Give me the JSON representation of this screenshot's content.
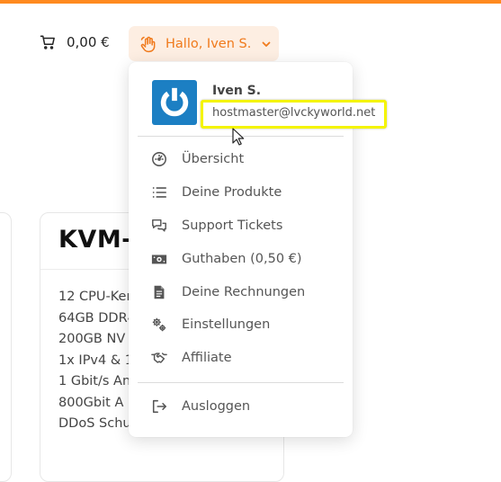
{
  "header": {
    "cart_total": "0,00 €",
    "greeting": "Hallo, Iven S.",
    "accent_color": "#f07a1c",
    "icons": {
      "cart": "cart-icon",
      "greeting": "waving-hand-icon",
      "chevron": "chevron-down-icon"
    }
  },
  "product_card": {
    "title": "KVM-",
    "features": [
      "12 CPU-Ker",
      "64GB DDR4",
      "200GB NV",
      "1x IPv4 & 1x",
      "1 Gbit/s An",
      "800Gbit A",
      "DDoS Schu"
    ]
  },
  "user_menu": {
    "user_name": "Iven S.",
    "email": "hostmaster@lvckyworld.net",
    "avatar_icon": "power-icon",
    "items": [
      {
        "label": "Übersicht",
        "icon": "dashboard-gauge-icon"
      },
      {
        "label": "Deine Produkte",
        "icon": "list-icon"
      },
      {
        "label": "Support Tickets",
        "icon": "chat-bubbles-icon"
      },
      {
        "label": "Guthaben (0,50 €)",
        "icon": "money-icon"
      },
      {
        "label": "Deine Rechnungen",
        "icon": "document-icon"
      },
      {
        "label": "Einstellungen",
        "icon": "gears-icon"
      },
      {
        "label": "Affiliate",
        "icon": "handshake-icon"
      }
    ],
    "logout": {
      "label": "Ausloggen",
      "icon": "logout-icon"
    }
  }
}
